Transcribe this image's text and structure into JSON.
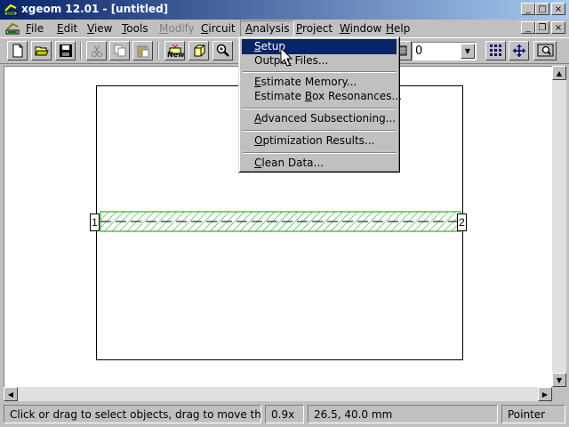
{
  "window": {
    "title": "xgeom 12.01 - [untitled]",
    "controls": {
      "minimize": "_",
      "maximize": "□",
      "close": "×"
    },
    "mdi_controls": {
      "minimize": "_",
      "restore": "❐",
      "close": "×"
    },
    "colors": {
      "titlebar_start": "#0a246a",
      "titlebar_end": "#a6caf0"
    }
  },
  "menubar": {
    "items": [
      {
        "mnemonic": "F",
        "rest": "ile",
        "disabled": false
      },
      {
        "mnemonic": "E",
        "rest": "dit",
        "disabled": false
      },
      {
        "mnemonic": "V",
        "rest": "iew",
        "disabled": false
      },
      {
        "mnemonic": "T",
        "rest": "ools",
        "disabled": false
      },
      {
        "mnemonic": "M",
        "rest": "odify",
        "disabled": true
      },
      {
        "mnemonic": "C",
        "rest": "ircuit",
        "disabled": false
      },
      {
        "mnemonic": "A",
        "rest": "nalysis",
        "disabled": false,
        "open": true
      },
      {
        "mnemonic": "P",
        "rest": "roject",
        "disabled": false
      },
      {
        "mnemonic": "W",
        "rest": "indow",
        "disabled": false
      },
      {
        "mnemonic": "H",
        "rest": "elp",
        "disabled": false
      }
    ]
  },
  "toolbar": {
    "new_label": "New",
    "level_value": "0",
    "icons": [
      "new-file-icon",
      "open-folder-icon",
      "save-icon",
      "cut-icon",
      "copy-icon",
      "paste-icon",
      "new-object-icon",
      "box-3d-icon",
      "zoom-in-icon",
      "layer-icon",
      "select-grid-icon",
      "move-arrows-icon",
      "zoom-fit-icon"
    ]
  },
  "analysis_menu": {
    "items": [
      {
        "pre": "",
        "mn": "S",
        "post": "etup",
        "selected": true
      },
      {
        "pre": "Outpu",
        "mn": "t",
        "post": " Files...",
        "selected": false
      },
      {
        "pre": "",
        "mn": "E",
        "post": "stimate Memory...",
        "selected": false
      },
      {
        "pre": "Estimate ",
        "mn": "B",
        "post": "ox Resonances...",
        "selected": false
      },
      {
        "pre": "",
        "mn": "A",
        "post": "dvanced Subsectioning...",
        "selected": false
      },
      {
        "pre": "",
        "mn": "O",
        "post": "ptimization Results...",
        "selected": false
      },
      {
        "pre": "",
        "mn": "C",
        "post": "lean Data...",
        "selected": false
      }
    ]
  },
  "canvas": {
    "port_left": "1",
    "port_right": "2",
    "strip_color": "#00a000"
  },
  "statusbar": {
    "message": "Click or drag to select objects, drag to move them",
    "zoom": "0.9x",
    "coordinates": "26.5, 40.0 mm",
    "mode": "Pointer"
  }
}
